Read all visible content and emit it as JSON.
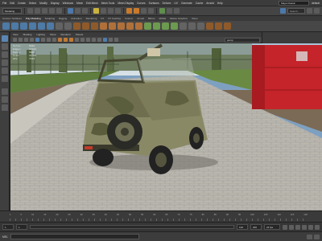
{
  "menubar": {
    "items": [
      "File",
      "Edit",
      "Create",
      "Select",
      "Modify",
      "Display",
      "Windows",
      "Mesh",
      "Edit Mesh",
      "Mesh Tools",
      "Mesh Display",
      "Curves",
      "Surfaces",
      "Deform",
      "UV",
      "Generate",
      "Cache",
      "Arnold",
      "Help"
    ],
    "workspace_value": "Maya Classic",
    "user_label": "default"
  },
  "statusline": {
    "mode_value": "Modeling",
    "search_placeholder": "Search..."
  },
  "shelf": {
    "tabs": [
      "Curves / Surfaces",
      "Poly Modeling",
      "Sculpting",
      "Rigging",
      "Animation",
      "Rendering",
      "FX",
      "FX Caching",
      "Custom",
      "Arnold",
      "Bifrost",
      "MASH",
      "Motion Graphics",
      "XGen"
    ],
    "active_tab_index": 1
  },
  "panel": {
    "menus": [
      "View",
      "Shading",
      "Lighting",
      "Show",
      "Renderer",
      "Panels"
    ],
    "camera_value": "persp"
  },
  "hud": {
    "rows": [
      {
        "key": "Verts:",
        "value": "6048"
      },
      {
        "key": "Edges:",
        "value": "11942"
      },
      {
        "key": "Faces:",
        "value": "5928"
      },
      {
        "key": "Tris:",
        "value": "11786"
      },
      {
        "key": "UVs:",
        "value": "7164"
      }
    ]
  },
  "timeslider": {
    "ticks": [
      "1",
      "5",
      "10",
      "15",
      "20",
      "25",
      "30",
      "35",
      "40",
      "45",
      "50",
      "55",
      "60",
      "65",
      "70",
      "75",
      "80",
      "85",
      "90",
      "95",
      "100",
      "105",
      "110",
      "115",
      "120"
    ]
  },
  "range": {
    "start": "1",
    "playback_start": "1",
    "playback_end": "120",
    "end": "200",
    "fps_label": "24 fps"
  },
  "commandline": {
    "label": "MEL"
  },
  "colors": {
    "accent": "#5a86b4",
    "highlight_orange": "#c97a2b"
  }
}
